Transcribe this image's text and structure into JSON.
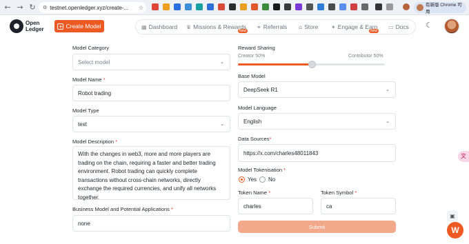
{
  "browser": {
    "url": "testnet.openledger.xyz/create-...",
    "profile_label": "有新版 Chrome 可用",
    "back_icon": "arrow-left",
    "forward_icon": "arrow-right",
    "reload_icon": "reload"
  },
  "header": {
    "logo_line1": "Open",
    "logo_line2": "Ledger",
    "create_label": "Create Model",
    "nav": {
      "dashboard": "Dashboard",
      "missions": "Missions & Rewards",
      "referrals": "Referrals",
      "store": "Store",
      "engage": "Engage & Earn",
      "docs": "Docs",
      "new_badge": "New"
    }
  },
  "form": {
    "model_category": {
      "label": "Model Category",
      "placeholder": "Select model"
    },
    "model_name": {
      "label": "Model Name",
      "value": "Robot trading"
    },
    "model_type": {
      "label": "Model Type",
      "value": "text"
    },
    "model_description": {
      "label": "Model Description",
      "value": "With the changes in web3, more and more players are trading on the chain, requiring a faster and better trading environment. Robot trading can quickly complete transactions without cross-chain networks, directly exchange the required currencies, and unify all networks together."
    },
    "business_model": {
      "label": "Business Model and Potential Applications",
      "value": "none"
    },
    "reward_sharing": {
      "label": "Reward Sharing",
      "creator": "Creator 50%",
      "contributor": "Contributor 50%",
      "creator_share": 0.5
    },
    "base_model": {
      "label": "Base Model",
      "value": "DeepSeek R1"
    },
    "model_language": {
      "label": "Model Language",
      "value": "English"
    },
    "data_sources": {
      "label": "Data Sources",
      "value": "https://x.com/charles48011843"
    },
    "model_tokenisation": {
      "label": "Model Tokenisation",
      "yes": "Yes",
      "no": "No",
      "selected": "Yes"
    },
    "token_name": {
      "label": "Token Name",
      "value": "charles"
    },
    "token_symbol": {
      "label": "Token Symbol",
      "value": "ca"
    },
    "submit_label": "Submit",
    "required_mark": "*"
  },
  "floating": {
    "w_label": "W"
  },
  "colors": {
    "accent": "#ee5a24",
    "submit_disabled": "#f2a98b"
  }
}
